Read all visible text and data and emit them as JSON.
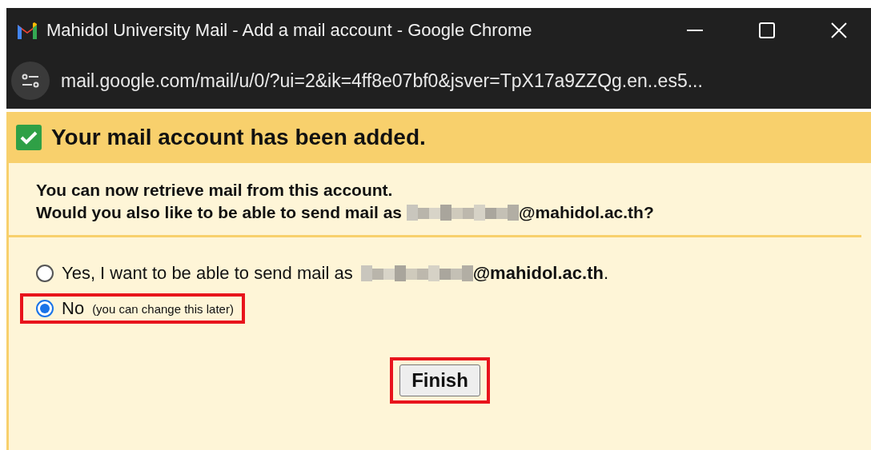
{
  "window": {
    "title": "Mahidol University Mail - Add a mail account - Google Chrome"
  },
  "address_bar": {
    "url": "mail.google.com/mail/u/0/?ui=2&ik=4ff8e07bf0&jsver=TpX17a9ZZQg.en..es5..."
  },
  "banner": {
    "title": "Your mail account has been added.",
    "checked": true
  },
  "message": {
    "line_1": "You can now retrieve mail from this account.",
    "line_2_before": "Would you also like to be able to send mail as",
    "line_2_after": "@mahidol.ac.th?"
  },
  "options": [
    {
      "label_before": "Yes, I want to be able to send mail as",
      "label_after": "**@mahidol.ac.th**.",
      "redacted": true,
      "selected": false,
      "highlighted": false
    },
    {
      "label_before": "No",
      "note": "(you can change this later)",
      "redacted": false,
      "selected": true,
      "highlighted": true
    }
  ],
  "finish_button": {
    "label": "Finish",
    "highlighted": true
  }
}
